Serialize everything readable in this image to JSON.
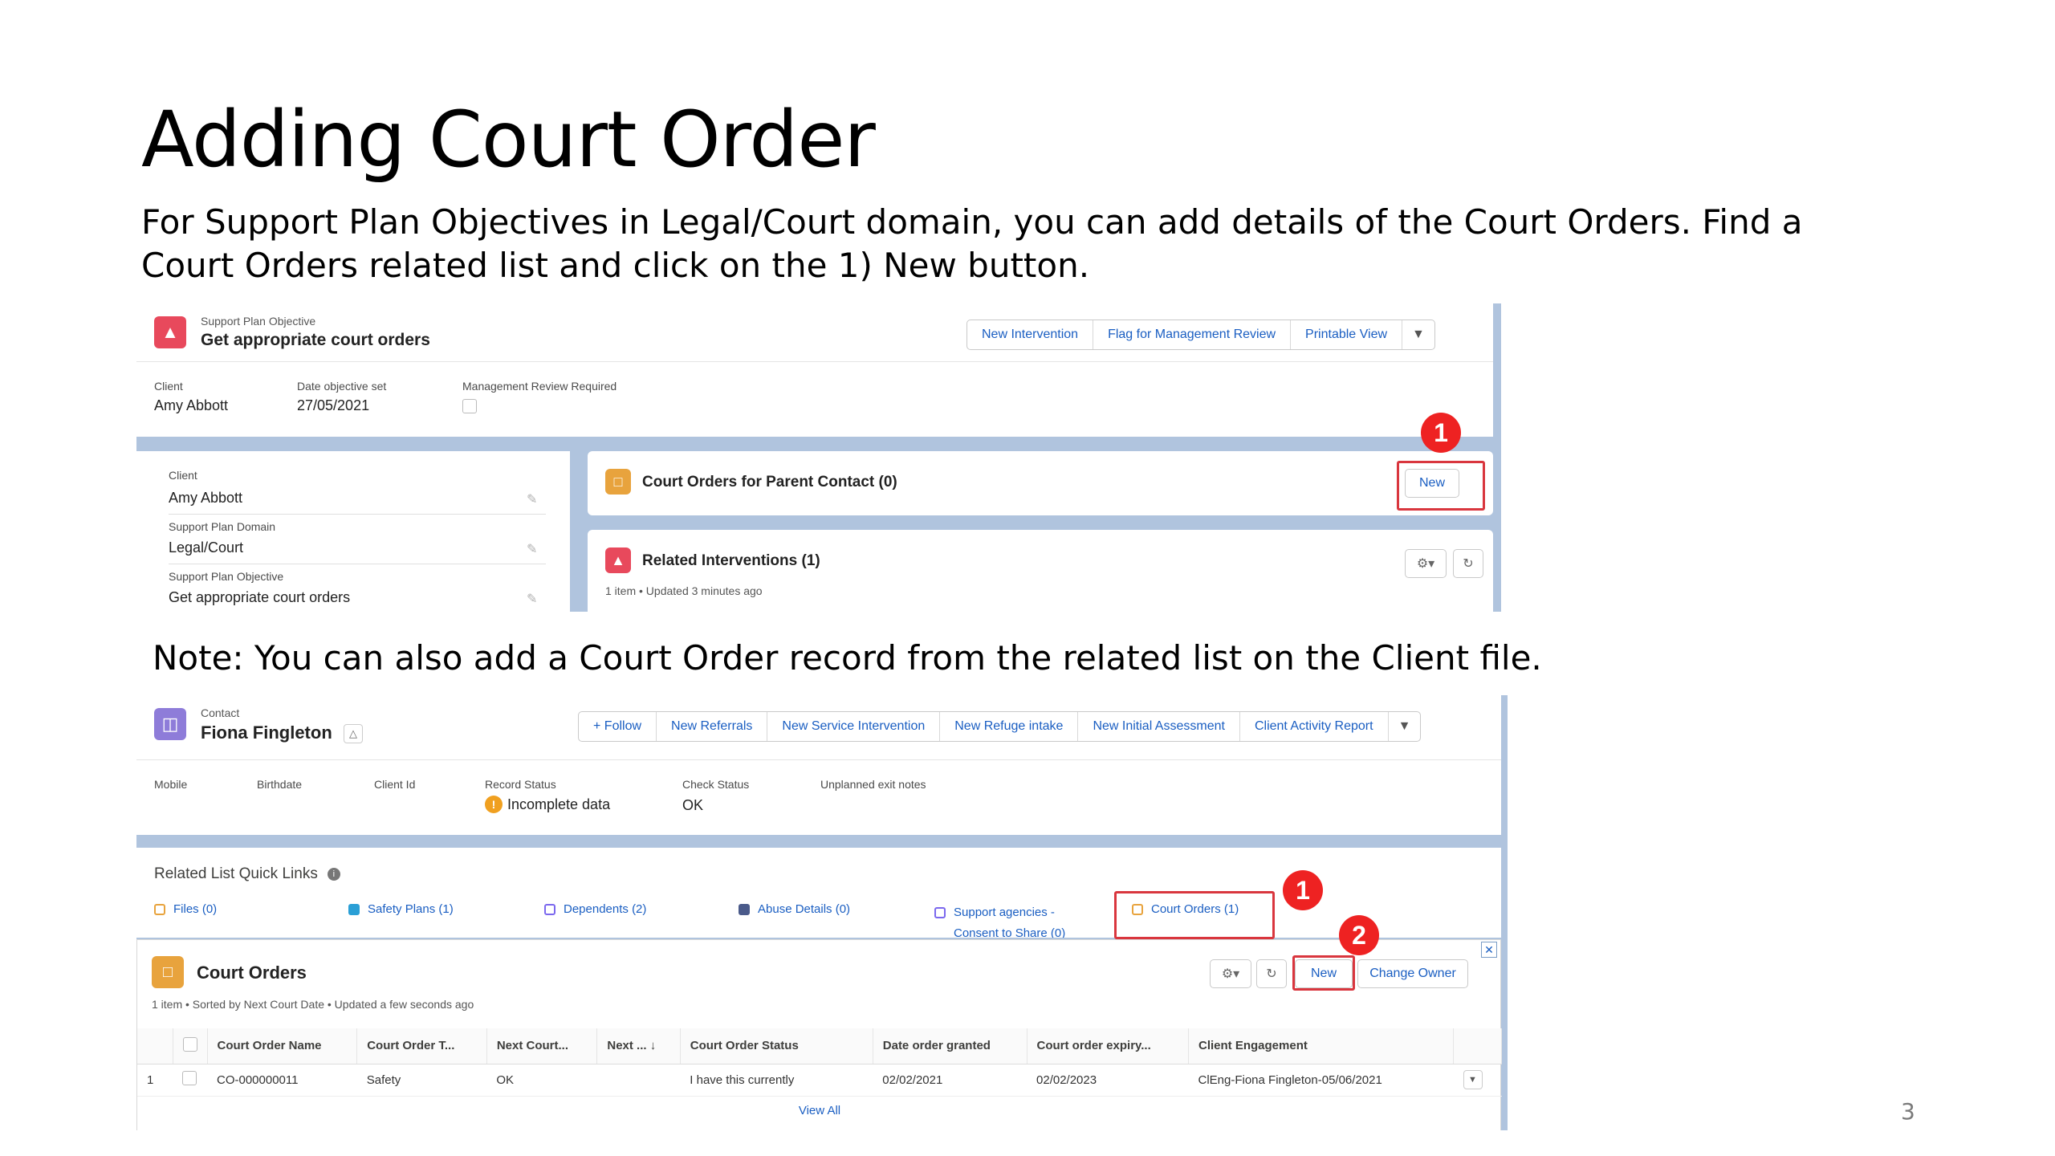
{
  "slide": {
    "title": "Adding Court Order",
    "body": "For Support Plan Objectives in Legal/Court domain, you can add details of the Court Orders. Find a Court Orders related list and click on the 1) New button.",
    "note": "Note: You can also add a Court Order record from the related list on the Client file.",
    "page_number": "3"
  },
  "shot1": {
    "object_label": "Support Plan Objective",
    "record_name": "Get appropriate court orders",
    "actions": [
      "New Intervention",
      "Flag for Management Review",
      "Printable View"
    ],
    "highlights": [
      {
        "label": "Client",
        "value": "Amy Abbott"
      },
      {
        "label": "Date objective set",
        "value": "27/05/2021"
      },
      {
        "label": "Management Review Required",
        "value": ""
      }
    ],
    "details": [
      {
        "label": "Client",
        "value": "Amy Abbott"
      },
      {
        "label": "Support Plan Domain",
        "value": "Legal/Court"
      },
      {
        "label": "Support Plan Objective",
        "value": "Get appropriate court orders"
      }
    ],
    "court_orders_card": {
      "title": "Court Orders for Parent Contact (0)",
      "new_label": "New"
    },
    "interventions_card": {
      "title": "Related Interventions (1)",
      "subtitle": "1 item • Updated 3 minutes ago"
    },
    "callout": "1"
  },
  "shot2": {
    "object_label": "Contact",
    "record_name": "Fiona Fingleton",
    "actions": [
      "+ Follow",
      "New Referrals",
      "New Service Intervention",
      "New Refuge intake",
      "New Initial Assessment",
      "Client Activity Report"
    ],
    "highlights": [
      {
        "label": "Mobile",
        "value": ""
      },
      {
        "label": "Birthdate",
        "value": ""
      },
      {
        "label": "Client Id",
        "value": ""
      },
      {
        "label": "Record Status",
        "value": "Incomplete data"
      },
      {
        "label": "Check Status",
        "value": "OK"
      },
      {
        "label": "Unplanned exit notes",
        "value": ""
      }
    ],
    "quick_links_title": "Related List Quick Links",
    "quick_links": [
      {
        "label": "Files (0)",
        "color": "#e8a33d"
      },
      {
        "label": "Safety Plans (1)",
        "color": "#2a9fd6"
      },
      {
        "label": "Dependents (2)",
        "color": "#7b68ee"
      },
      {
        "label": "Abuse Details (0)",
        "color": "#4a5a8a"
      },
      {
        "label": "Support agencies - Consent to Share (0)",
        "color": "#7b68ee"
      },
      {
        "label": "Court Orders (1)",
        "color": "#e8a33d"
      }
    ],
    "court_orders": {
      "title": "Court Orders",
      "subtitle": "1 item • Sorted by Next Court Date • Updated a few seconds ago",
      "new_label": "New",
      "change_owner_label": "Change Owner",
      "columns": [
        "Court Order Name",
        "Court Order T...",
        "Next Court...",
        "Next ... ↓",
        "Court Order Status",
        "Date order granted",
        "Court order expiry...",
        "Client Engagement"
      ],
      "rows": [
        {
          "num": "1",
          "cells": [
            "CO-000000011",
            "Safety",
            "OK",
            "",
            "I have this currently",
            "02/02/2021",
            "02/02/2023",
            "ClEng-Fiona Fingleton-05/06/2021"
          ]
        }
      ],
      "view_all": "View All"
    },
    "callouts": [
      "1",
      "2"
    ]
  }
}
